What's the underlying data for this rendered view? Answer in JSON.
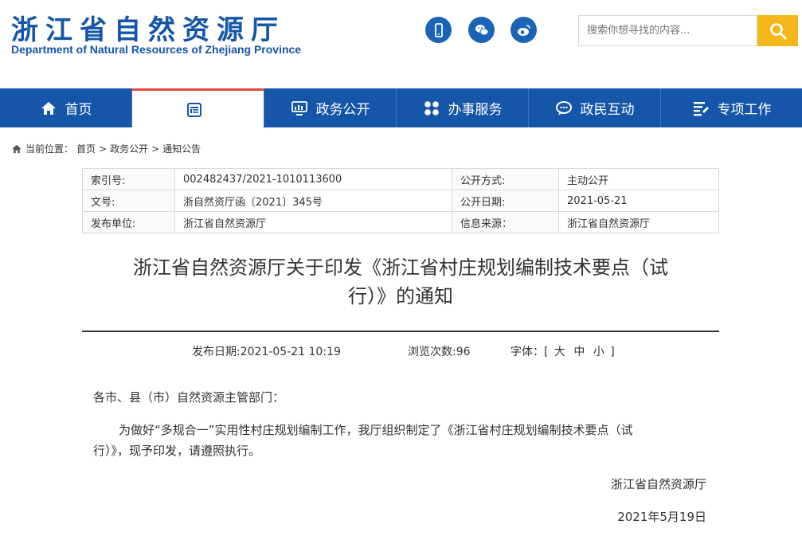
{
  "header": {
    "logo_cn": "浙江省自然资源厅",
    "logo_en": "Department of Natural Resources of Zhejiang Province",
    "social_icons": [
      "mobile-icon",
      "wechat-icon",
      "weibo-icon"
    ],
    "search_placeholder": "搜索你想寻找的内容..."
  },
  "nav": {
    "items": [
      {
        "label": "首页",
        "icon": "home-icon"
      },
      {
        "label": "",
        "icon": "document-icon",
        "active": true
      },
      {
        "label": "政务公开",
        "icon": "monitor-icon"
      },
      {
        "label": "办事服务",
        "icon": "grid-icon"
      },
      {
        "label": "政民互动",
        "icon": "chat-icon"
      },
      {
        "label": "专项工作",
        "icon": "list-icon"
      }
    ]
  },
  "breadcrumb": {
    "prefix": "当前位置：",
    "items": [
      "首页",
      "政务公开",
      "通知公告"
    ],
    "separator": ">"
  },
  "meta": {
    "rows": [
      [
        "索引号:",
        "002482437/2021-1010113600",
        "公开方式:",
        "主动公开"
      ],
      [
        "文号:",
        "浙自然资厅函〔2021〕345号",
        "公开日期:",
        "2021-05-21"
      ],
      [
        "发布单位:",
        "浙江省自然资源厅",
        "信息来源：",
        "浙江省自然资源厅"
      ]
    ]
  },
  "article": {
    "title_line1": "浙江省自然资源厅关于印发《浙江省村庄规划编制技术要点（试",
    "title_line2": "行）》的通知",
    "publish_date": "发布日期:2021-05-21 10:19",
    "views": "浏览次数:96",
    "font_label": "字体：[",
    "font_large": "大",
    "font_medium": "中",
    "font_small": "小",
    "font_end": "]",
    "salutation": "各市、县（市）自然资源主管部门：",
    "para_line1": "为做好“多规合一”实用性村庄规划编制工作，我厅组织制定了《浙江省村庄规划编制技术要点（试",
    "para_line2": "行）》，现予印发，请遵照执行。",
    "signer": "浙江省自然资源厅",
    "sign_date": "2021年5月19日"
  },
  "colors": {
    "brand_blue": "#1656a8",
    "accent_yellow": "#f5b81c",
    "active_red": "#e44a3c"
  }
}
